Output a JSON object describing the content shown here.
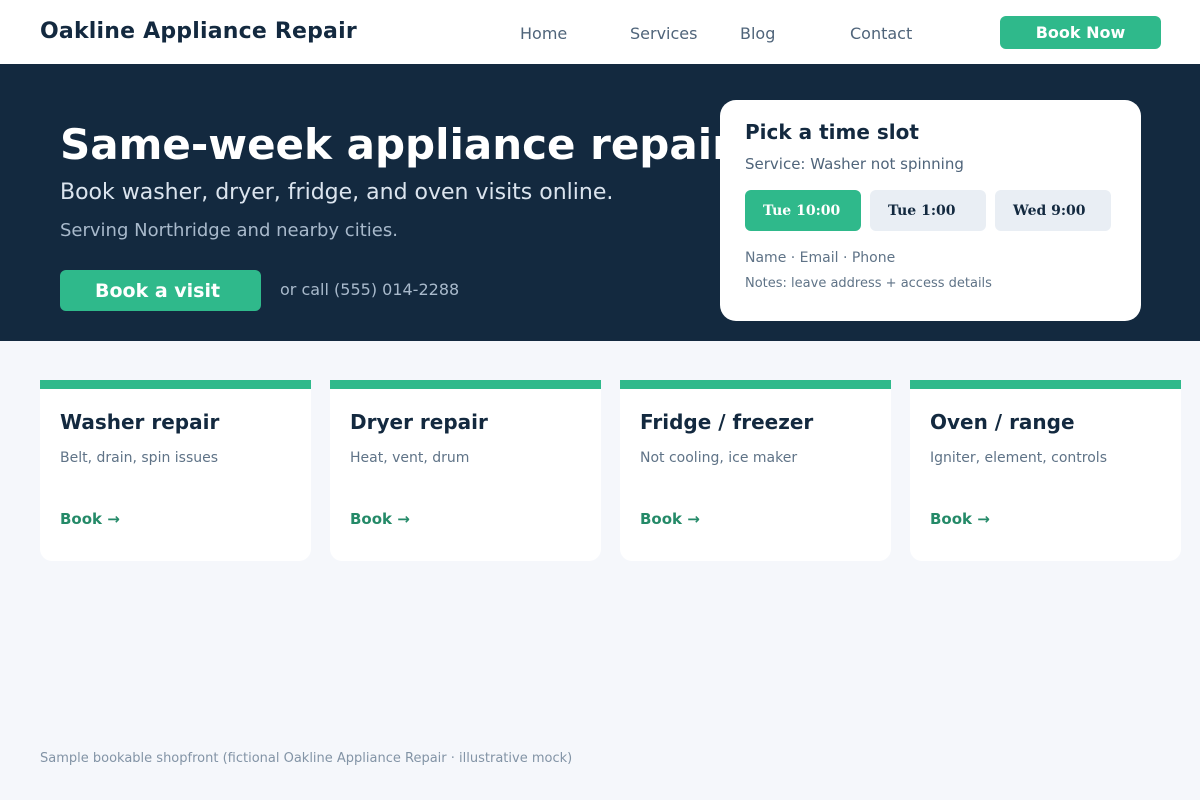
{
  "header": {
    "brand": "Oakline Appliance Repair",
    "nav": {
      "home": "Home",
      "services": "Services",
      "blog": "Blog",
      "contact": "Contact"
    },
    "cta_label": "Book Now"
  },
  "hero": {
    "title": "Same-week appliance repairs",
    "subtitle": "Book washer, dryer, fridge, and oven visits online.",
    "service_area": "Serving Northridge and nearby cities.",
    "cta_label": "Book a visit",
    "phone_text": "or call (555) 014-2288"
  },
  "booking": {
    "title": "Pick a time slot",
    "service": "Service: Washer not spinning",
    "slots": [
      {
        "label": "Tue 10:00",
        "selected": true
      },
      {
        "label": "Tue 1:00",
        "selected": false
      },
      {
        "label": "Wed 9:00",
        "selected": false
      }
    ],
    "fields": "Name · Email · Phone",
    "notes": "Notes: leave address + access details"
  },
  "services": [
    {
      "title": "Washer repair",
      "desc": "Belt, drain, spin issues",
      "link": "Book →"
    },
    {
      "title": "Dryer repair",
      "desc": "Heat, vent, drum",
      "link": "Book →"
    },
    {
      "title": "Fridge / freezer",
      "desc": "Not cooling, ice maker",
      "link": "Book →"
    },
    {
      "title": "Oven / range",
      "desc": "Igniter, element, controls",
      "link": "Book →"
    }
  ],
  "footer": {
    "note": "Sample bookable shopfront (fictional Oakline Appliance Repair · illustrative mock)"
  },
  "colors": {
    "accent": "#2fb98b",
    "hero_bg": "#13293f",
    "page_bg": "#f5f7fb",
    "link": "#248a68"
  }
}
